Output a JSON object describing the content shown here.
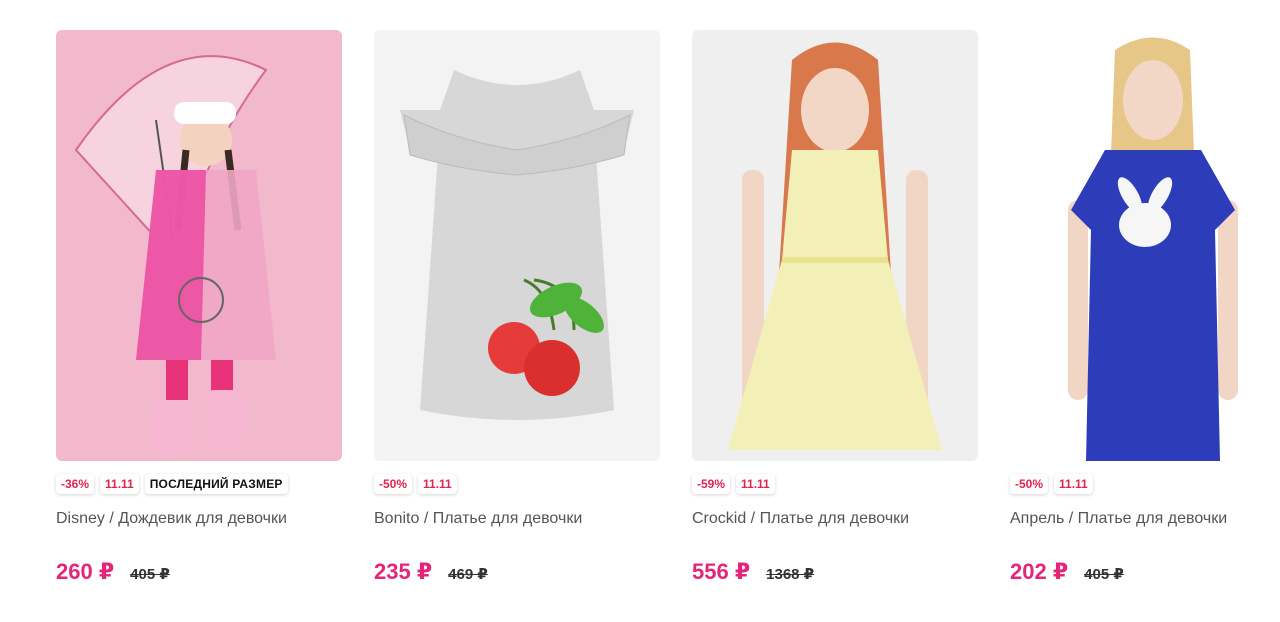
{
  "products": [
    {
      "brand_title": "Disney / Дождевик для девочки",
      "badges": [
        "-36%",
        "11.11",
        "ПОСЛЕДНИЙ РАЗМЕР"
      ],
      "price": "260 ₽",
      "old_price": "405 ₽",
      "image_bg": "#f2b8cc"
    },
    {
      "brand_title": "Bonito / Платье для девочки",
      "badges": [
        "-50%",
        "11.11"
      ],
      "price": "235 ₽",
      "old_price": "469 ₽",
      "image_bg": "#f3f3f3"
    },
    {
      "brand_title": "Crockid / Платье для девочки",
      "badges": [
        "-59%",
        "11.11"
      ],
      "price": "556 ₽",
      "old_price": "1368 ₽",
      "image_bg": "#efefef"
    },
    {
      "brand_title": "Апрель / Платье для девочки",
      "badges": [
        "-50%",
        "11.11"
      ],
      "price": "202 ₽",
      "old_price": "405 ₽",
      "image_bg": "#ffffff"
    }
  ],
  "colors": {
    "price": "#e4267a",
    "discount_badge": "#e2224f"
  }
}
